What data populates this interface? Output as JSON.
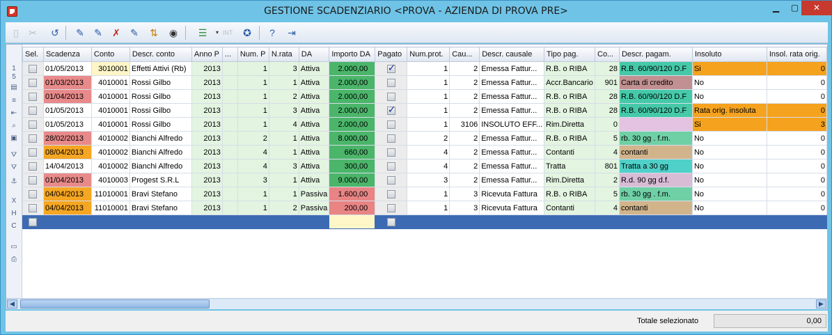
{
  "window": {
    "title": "GESTIONE SCADENZIARIO <PROVA - AZIENDA DI PROVA PRE>"
  },
  "toolbar": {
    "icons": [
      "new-icon",
      "delete-icon",
      "undo-icon",
      "edit-icon",
      "edit2-icon",
      "cancel-icon",
      "restore-icon",
      "sort-icon",
      "binoculars-icon",
      "view-icon",
      "int-icon",
      "compass-icon",
      "help-icon",
      "exit-icon"
    ]
  },
  "left_strip": {
    "row_count_top": "1",
    "row_count_bottom": "5"
  },
  "columns": [
    "Sel.",
    "Scadenza",
    "Conto",
    "Descr. conto",
    "Anno P",
    "...",
    "Num. P",
    "N.rata",
    "DA",
    "Importo DA",
    "Pagato",
    "Num.prot.",
    "Cau...",
    "Descr. causale",
    "Tipo pag.",
    "Co...",
    "Descr. pagam.",
    "Insoluto",
    "Insol. rata orig."
  ],
  "rows": [
    {
      "scadenza": "01/05/2013",
      "conto": "3010001",
      "descr_conto": "Effetti Attivi (Rb)",
      "anno": "2013",
      "num_p": "1",
      "rata": "3",
      "da": "Attiva",
      "importo": "2.000,00",
      "pagato": true,
      "num_prot": "1",
      "cau": "2",
      "descr_causale": "Emessa Fattur...",
      "tipo_pag": "R.B. o RIBA",
      "co": "28",
      "descr_pagam": "R.B. 60/90/120 D.F",
      "insoluto": "Si",
      "insol_orig": "0"
    },
    {
      "scadenza": "01/03/2013",
      "conto": "4010001",
      "descr_conto": "Rossi Gilbo",
      "anno": "2013",
      "num_p": "1",
      "rata": "1",
      "da": "Attiva",
      "importo": "2.000,00",
      "pagato": false,
      "num_prot": "1",
      "cau": "2",
      "descr_causale": "Emessa Fattur...",
      "tipo_pag": "Accr.Bancario",
      "co": "901",
      "descr_pagam": "Carta di credito",
      "insoluto": "No",
      "insol_orig": "0"
    },
    {
      "scadenza": "01/04/2013",
      "conto": "4010001",
      "descr_conto": "Rossi Gilbo",
      "anno": "2013",
      "num_p": "1",
      "rata": "2",
      "da": "Attiva",
      "importo": "2.000,00",
      "pagato": false,
      "num_prot": "1",
      "cau": "2",
      "descr_causale": "Emessa Fattur...",
      "tipo_pag": "R.B. o RIBA",
      "co": "28",
      "descr_pagam": "R.B. 60/90/120 D.F",
      "insoluto": "No",
      "insol_orig": "0"
    },
    {
      "scadenza": "01/05/2013",
      "conto": "4010001",
      "descr_conto": "Rossi Gilbo",
      "anno": "2013",
      "num_p": "1",
      "rata": "3",
      "da": "Attiva",
      "importo": "2.000,00",
      "pagato": true,
      "num_prot": "1",
      "cau": "2",
      "descr_causale": "Emessa Fattur...",
      "tipo_pag": "R.B. o RIBA",
      "co": "28",
      "descr_pagam": "R.B. 60/90/120 D.F",
      "insoluto": "Rata orig. insoluta",
      "insol_orig": "0"
    },
    {
      "scadenza": "01/05/2013",
      "conto": "4010001",
      "descr_conto": "Rossi Gilbo",
      "anno": "2013",
      "num_p": "1",
      "rata": "4",
      "da": "Attiva",
      "importo": "2.000,00",
      "pagato": false,
      "num_prot": "1",
      "cau": "3106",
      "descr_causale": "INSOLUTO EFF...",
      "tipo_pag": "Rim.Diretta",
      "co": "0",
      "descr_pagam": "",
      "insoluto": "Si",
      "insol_orig": "3"
    },
    {
      "scadenza": "28/02/2013",
      "conto": "4010002",
      "descr_conto": "Bianchi Alfredo",
      "anno": "2013",
      "num_p": "2",
      "rata": "1",
      "da": "Attiva",
      "importo": "8.000,00",
      "pagato": false,
      "num_prot": "2",
      "cau": "2",
      "descr_causale": "Emessa Fattur...",
      "tipo_pag": "R.B. o RIBA",
      "co": "5",
      "descr_pagam": "rb. 30 gg . f.m.",
      "insoluto": "No",
      "insol_orig": "0"
    },
    {
      "scadenza": "08/04/2013",
      "conto": "4010002",
      "descr_conto": "Bianchi Alfredo",
      "anno": "2013",
      "num_p": "4",
      "rata": "1",
      "da": "Attiva",
      "importo": "660,00",
      "pagato": false,
      "num_prot": "4",
      "cau": "2",
      "descr_causale": "Emessa Fattur...",
      "tipo_pag": "Contanti",
      "co": "4",
      "descr_pagam": "contanti",
      "insoluto": "No",
      "insol_orig": "0"
    },
    {
      "scadenza": "14/04/2013",
      "conto": "4010002",
      "descr_conto": "Bianchi Alfredo",
      "anno": "2013",
      "num_p": "4",
      "rata": "3",
      "da": "Attiva",
      "importo": "300,00",
      "pagato": false,
      "num_prot": "4",
      "cau": "2",
      "descr_causale": "Emessa Fattur...",
      "tipo_pag": "Tratta",
      "co": "801",
      "descr_pagam": "Tratta a 30 gg",
      "insoluto": "No",
      "insol_orig": "0"
    },
    {
      "scadenza": "01/04/2013",
      "conto": "4010003",
      "descr_conto": "Progest S.R.L",
      "anno": "2013",
      "num_p": "3",
      "rata": "1",
      "da": "Attiva",
      "importo": "9.000,00",
      "pagato": false,
      "num_prot": "3",
      "cau": "2",
      "descr_causale": "Emessa Fattur...",
      "tipo_pag": "Rim.Diretta",
      "co": "2",
      "descr_pagam": "R.d. 90 gg d.f.",
      "insoluto": "No",
      "insol_orig": "0"
    },
    {
      "scadenza": "04/04/2013",
      "conto": "11010001",
      "descr_conto": "Bravi Stefano",
      "anno": "2013",
      "num_p": "1",
      "rata": "1",
      "da": "Passiva",
      "importo": "1.600,00",
      "pagato": false,
      "num_prot": "1",
      "cau": "3",
      "descr_causale": "Ricevuta Fattura",
      "tipo_pag": "R.B. o RIBA",
      "co": "5",
      "descr_pagam": "rb. 30 gg . f.m.",
      "insoluto": "No",
      "insol_orig": "0"
    },
    {
      "scadenza": "04/04/2013",
      "conto": "11010001",
      "descr_conto": "Bravi Stefano",
      "anno": "2013",
      "num_p": "1",
      "rata": "2",
      "da": "Passiva",
      "importo": "200,00",
      "pagato": false,
      "num_prot": "1",
      "cau": "3",
      "descr_causale": "Ricevuta Fattura",
      "tipo_pag": "Contanti",
      "co": "4",
      "descr_pagam": "contanti",
      "insoluto": "No",
      "insol_orig": "0"
    }
  ],
  "row_styles": {
    "scadenza": [
      "",
      "red",
      "red",
      "",
      "",
      "red",
      "orange",
      "",
      "red",
      "orange",
      "orange"
    ],
    "conto": [
      "yellow",
      "",
      "",
      "",
      "",
      "",
      "",
      "",
      "",
      "",
      ""
    ],
    "importo": [
      "imp-green",
      "imp-green",
      "imp-green",
      "imp-green",
      "imp-green",
      "imp-green",
      "imp-green",
      "imp-green",
      "imp-green",
      "imp-red",
      "imp-red"
    ],
    "pagam": [
      "pg-riba",
      "pg-carta",
      "pg-riba",
      "pg-riba",
      "pg-empty",
      "pg-fm",
      "pg-contanti",
      "pg-tratta",
      "pg-rd",
      "pg-fm",
      "pg-contanti"
    ],
    "insoluto": [
      "ins-orange",
      "",
      "",
      "ins-orange",
      "ins-orange",
      "",
      "",
      "",
      "",
      "",
      ""
    ],
    "insol_orig": [
      "ins-orange",
      "",
      "",
      "ins-orange",
      "ins-orange",
      "",
      "",
      "",
      "",
      "",
      ""
    ]
  },
  "status": {
    "total_label": "Totale selezionato",
    "total_value": "0,00"
  },
  "colors": {
    "titlebar": "#6fc3e6",
    "selected_row": "#3d6bb3",
    "green": "#4bb56a",
    "red": "#e88484",
    "orange": "#f5a623"
  }
}
